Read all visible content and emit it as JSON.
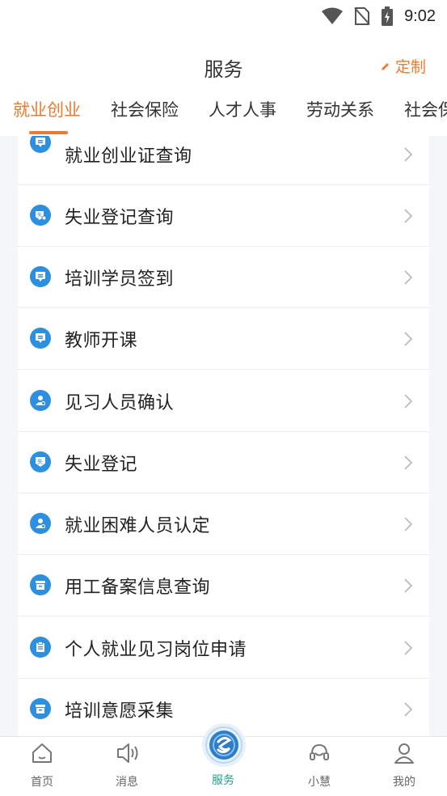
{
  "status_bar": {
    "time": "9:02"
  },
  "header": {
    "title": "服务",
    "custom_label": "定制"
  },
  "tabs": [
    {
      "label": "就业创业",
      "active": true
    },
    {
      "label": "社会保险"
    },
    {
      "label": "人才人事"
    },
    {
      "label": "劳动关系"
    },
    {
      "label": "社会保"
    }
  ],
  "services": [
    {
      "label": "就业创业证查询",
      "icon": "card-icon"
    },
    {
      "label": "失业登记查询",
      "icon": "unemployment-search-icon"
    },
    {
      "label": "培训学员签到",
      "icon": "card-icon"
    },
    {
      "label": "教师开课",
      "icon": "card-icon"
    },
    {
      "label": "见习人员确认",
      "icon": "person-icon"
    },
    {
      "label": "失业登记",
      "icon": "unemployment-icon"
    },
    {
      "label": "就业困难人员认定",
      "icon": "person-icon"
    },
    {
      "label": "用工备案信息查询",
      "icon": "archive-icon"
    },
    {
      "label": "个人就业见习岗位申请",
      "icon": "clipboard-icon"
    },
    {
      "label": "培训意愿采集",
      "icon": "archive-icon"
    }
  ],
  "tabbar": [
    {
      "label": "首页",
      "icon": "home-icon"
    },
    {
      "label": "消息",
      "icon": "speaker-icon"
    },
    {
      "label": "服务",
      "icon": "service-logo-icon",
      "active": true
    },
    {
      "label": "小慧",
      "icon": "headset-icon"
    },
    {
      "label": "我的",
      "icon": "user-icon"
    }
  ],
  "colors": {
    "accent": "#ef7a2e",
    "icon_blue": "#2d8fdf",
    "tab_active": "#1fa38f"
  }
}
